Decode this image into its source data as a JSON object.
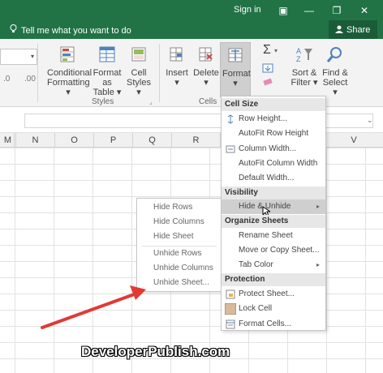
{
  "titlebar": {
    "signin": "Sign in",
    "icons": [
      "ribbon-display-icon",
      "minimize-icon",
      "restore-icon",
      "close-icon"
    ]
  },
  "tellme": {
    "placeholder": "Tell me what you want to do",
    "share": "Share"
  },
  "ribbon": {
    "buttons": {
      "conditional_formatting": [
        "Conditional",
        "Formatting ▾"
      ],
      "format_as_table": [
        "Format as",
        "Table ▾"
      ],
      "cell_styles": [
        "Cell",
        "Styles ▾"
      ],
      "insert": [
        "Insert",
        "▾"
      ],
      "delete": [
        "Delete",
        "▾"
      ],
      "format": [
        "Format",
        "▾"
      ],
      "sort_filter": [
        "Sort &",
        "Filter ▾"
      ],
      "find_select": [
        "Find &",
        "Select ▾"
      ]
    },
    "groups": {
      "styles": "Styles",
      "cells": "Cells"
    }
  },
  "columns": [
    "M",
    "N",
    "O",
    "P",
    "Q",
    "R",
    "V"
  ],
  "format_menu": {
    "sections": {
      "cell_size": "Cell Size",
      "visibility": "Visibility",
      "organize": "Organize Sheets",
      "protection": "Protection"
    },
    "items": {
      "row_height": "Row Height...",
      "autofit_row": "AutoFit Row Height",
      "column_width": "Column Width...",
      "autofit_column": "AutoFit Column Width",
      "default_width": "Default Width...",
      "hide_unhide": "Hide & Unhide",
      "rename_sheet": "Rename Sheet",
      "move_copy": "Move or Copy Sheet...",
      "tab_color": "Tab Color",
      "protect_sheet": "Protect Sheet...",
      "lock_cell": "Lock Cell",
      "format_cells": "Format Cells..."
    }
  },
  "submenu": {
    "items": [
      "Hide Rows",
      "Hide Columns",
      "Hide Sheet",
      "Unhide Rows",
      "Unhide Columns",
      "Unhide Sheet..."
    ]
  },
  "watermark": "DeveloperPublish.com",
  "colors": {
    "excel_green": "#217346",
    "annotation_red": "#e03a35"
  }
}
